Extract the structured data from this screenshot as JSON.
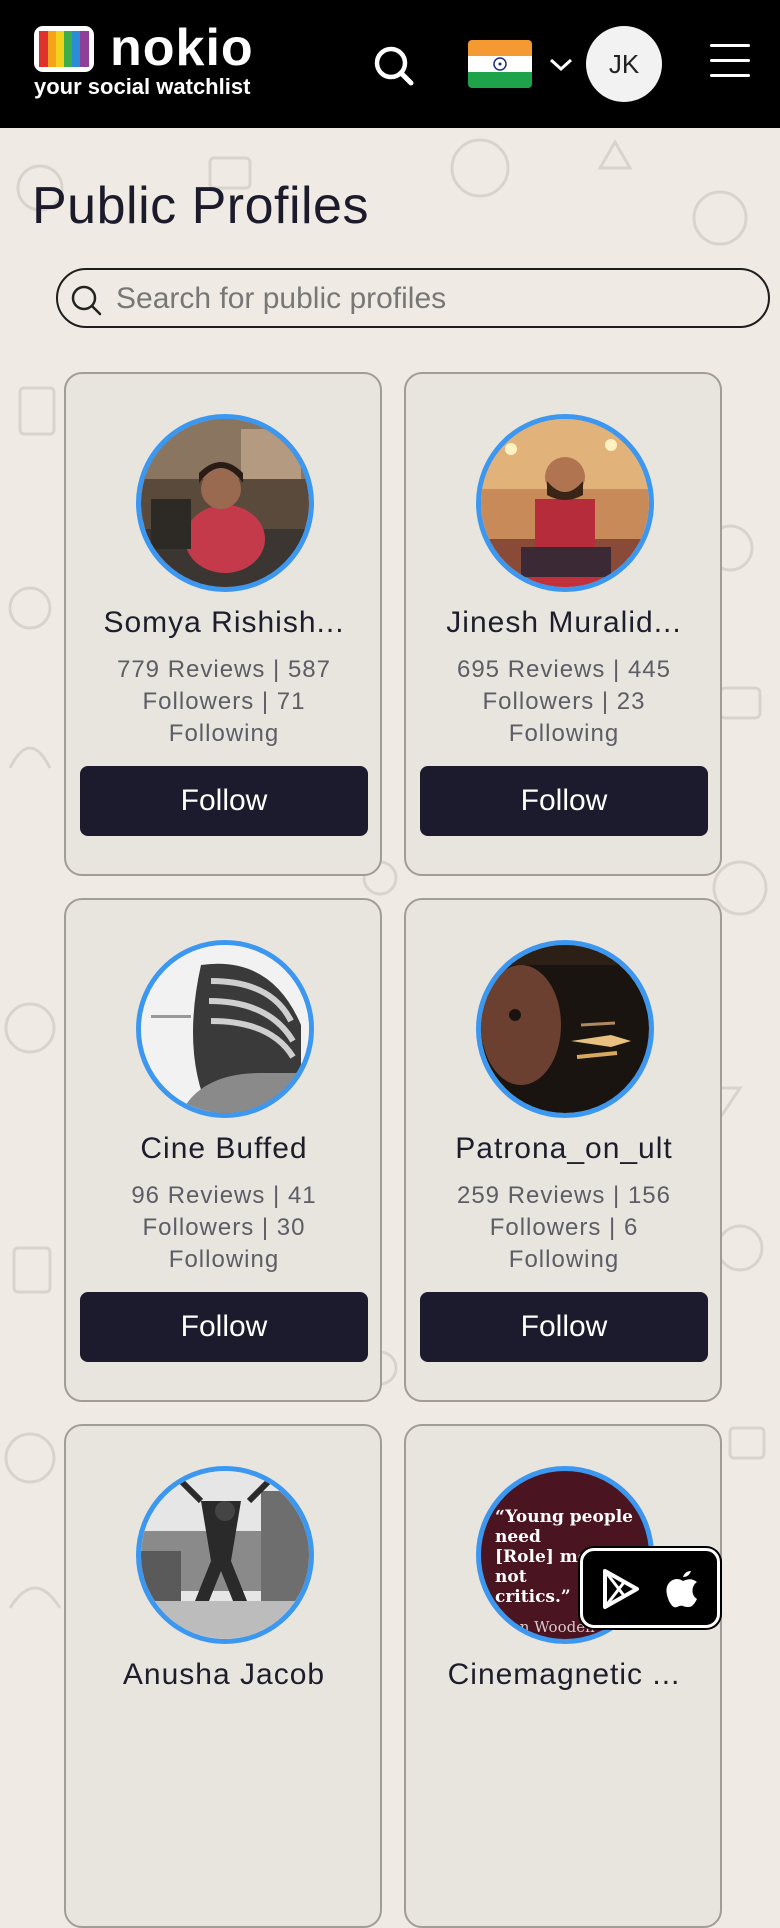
{
  "header": {
    "logo_word": "nokio",
    "tagline": "your social watchlist",
    "avatar_initials": "JK",
    "country": "India"
  },
  "page": {
    "title": "Public Profiles",
    "search_placeholder": "Search for public profiles"
  },
  "profiles": [
    {
      "name": "Somya Rishish...",
      "stats": "779 Reviews | 587 Followers | 71 Following",
      "follow_label": "Follow"
    },
    {
      "name": "Jinesh Muralid...",
      "stats": "695 Reviews | 445 Followers | 23 Following",
      "follow_label": "Follow"
    },
    {
      "name": "Cine Buffed",
      "stats": "96 Reviews | 41 Followers | 30 Following",
      "follow_label": "Follow"
    },
    {
      "name": "Patrona_on_ult",
      "stats": "259 Reviews | 156 Followers | 6 Following",
      "follow_label": "Follow"
    },
    {
      "name": "Anusha Jacob",
      "stats": "",
      "follow_label": ""
    },
    {
      "name": "Cinemagnetic ...",
      "stats": "",
      "follow_label": ""
    }
  ],
  "quote_avatar": {
    "line1": "“Young people need",
    "line2": "[Role] models, not",
    "line3": "critics.”",
    "author": "John Wooden"
  },
  "colors": {
    "header_bg": "#000000",
    "button_bg": "#1c1b2d",
    "avatar_ring": "#3b97f0",
    "page_bg": "#efebe4"
  }
}
